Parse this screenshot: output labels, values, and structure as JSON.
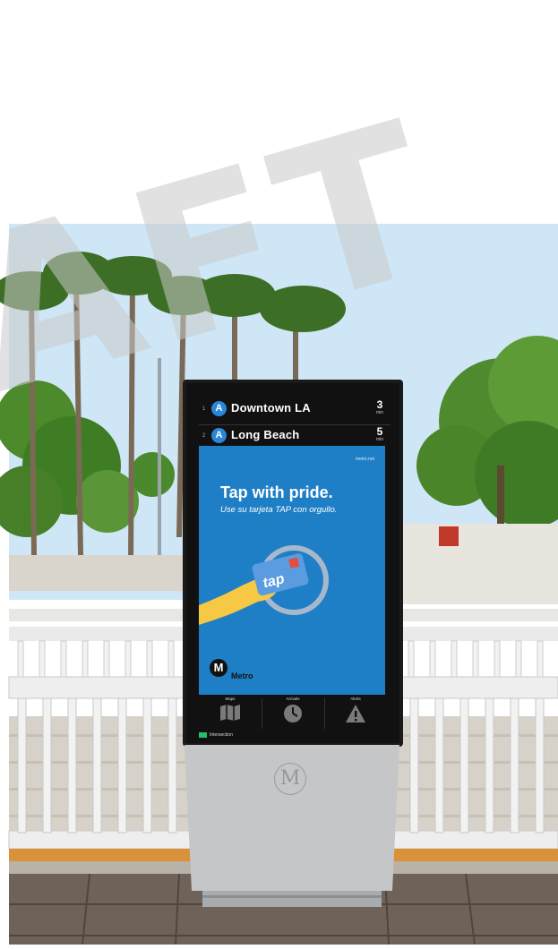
{
  "watermark": {
    "text": "AFT"
  },
  "kiosk": {
    "arrivals": [
      {
        "index": "1",
        "line": "A",
        "destination": "Downtown LA",
        "minutes": "3",
        "unit": "min"
      },
      {
        "index": "2",
        "line": "A",
        "destination": "Long Beach",
        "minutes": "5",
        "unit": "min"
      }
    ],
    "promo": {
      "url": "metro.net",
      "headline": "Tap with pride.",
      "subheadline": "Use su tarjeta TAP con orgullo.",
      "card_label": "tap",
      "metro_logo": "M",
      "metro_label": "Metro"
    },
    "nav": [
      {
        "label": "Maps",
        "icon": "map-icon"
      },
      {
        "label": "Arrivals",
        "icon": "clock-icon"
      },
      {
        "label": "Alerts",
        "icon": "warning-icon"
      }
    ],
    "brand": "Intersection",
    "pedestal_logo": "M"
  },
  "colors": {
    "sky": "#cfe6f6",
    "promo_blue": "#1f7fc6",
    "line_badge": "#2a86d8",
    "tap_card": "#5b9be0",
    "brand_green": "#22c06a"
  }
}
